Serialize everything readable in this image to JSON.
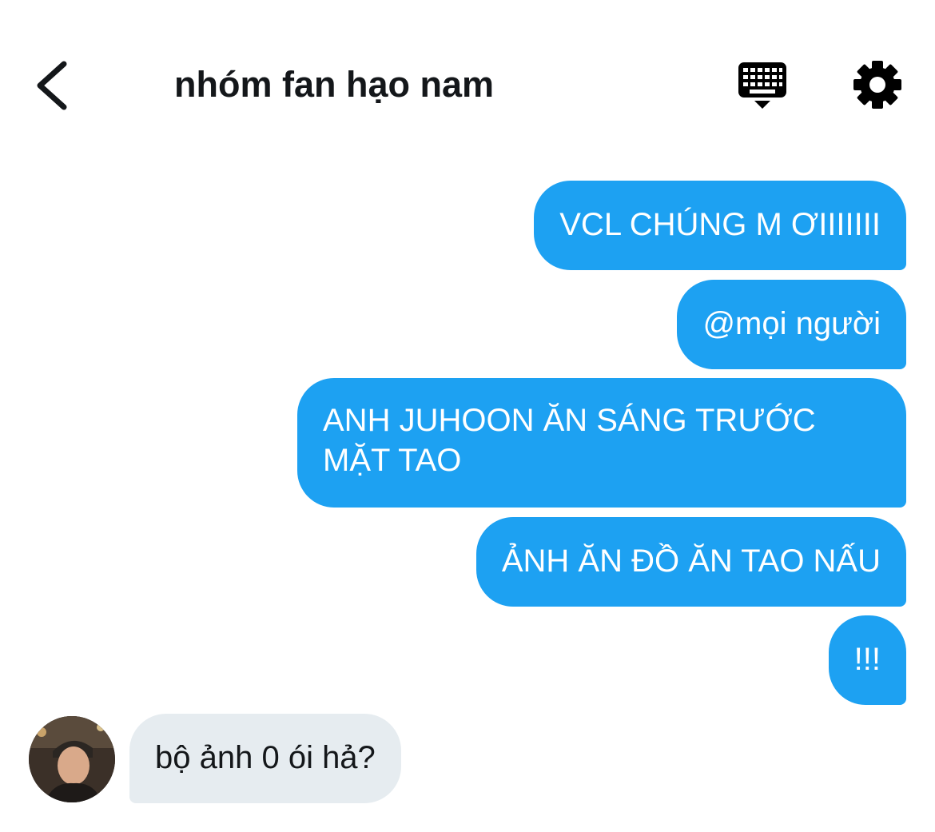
{
  "header": {
    "title": "nhóm fan hạo nam",
    "back_icon": "chevron-left-icon",
    "keyboard_icon": "keyboard-icon",
    "settings_icon": "gear-icon"
  },
  "messages": {
    "outgoing": [
      "VCL CHÚNG M ƠIIIIIII",
      "@mọi người",
      "ANH JUHOON ĂN SÁNG TRƯỚC MẶT TAO",
      "ẢNH ĂN ĐỒ ĂN TAO NẤU",
      "!!!"
    ],
    "incoming": [
      "bộ ảnh 0 ói hả?"
    ]
  },
  "colors": {
    "outgoing_bubble": "#1da1f2",
    "incoming_bubble": "#e6ecf0",
    "text_dark": "#14171a"
  }
}
